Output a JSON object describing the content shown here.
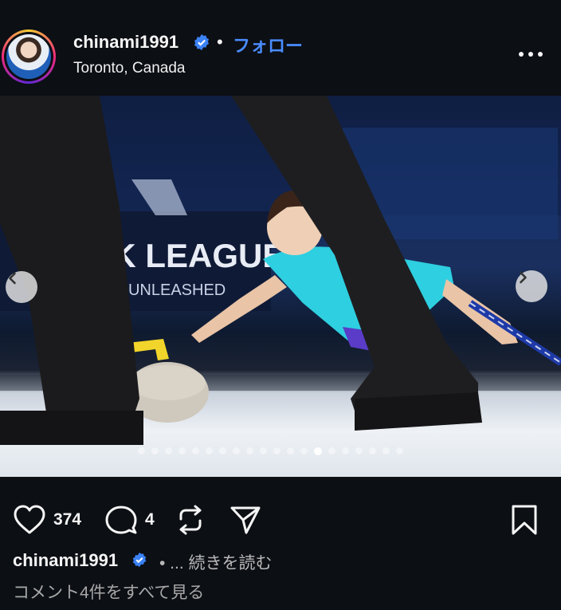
{
  "header": {
    "username": "chinami1991",
    "separator": "•",
    "follow_label": "フォロー",
    "location": "Toronto, Canada"
  },
  "carousel": {
    "total_slides": 20,
    "active_index": 13
  },
  "actions": {
    "likes_count": "374",
    "comments_count": "4"
  },
  "caption": {
    "username": "chinami1991",
    "more_label": "• ... 続きを読む"
  },
  "comments_link": "コメント4件をすべて見る",
  "colors": {
    "background": "#0c0f14",
    "follow": "#4a8cff",
    "verified": "#3b82f6"
  },
  "icons": {
    "like": "heart-icon",
    "comment": "comment-icon",
    "repost": "repost-icon",
    "share": "send-icon",
    "save": "bookmark-icon",
    "more": "more-options-icon",
    "prev": "chevron-left-icon",
    "next": "chevron-right-icon"
  }
}
